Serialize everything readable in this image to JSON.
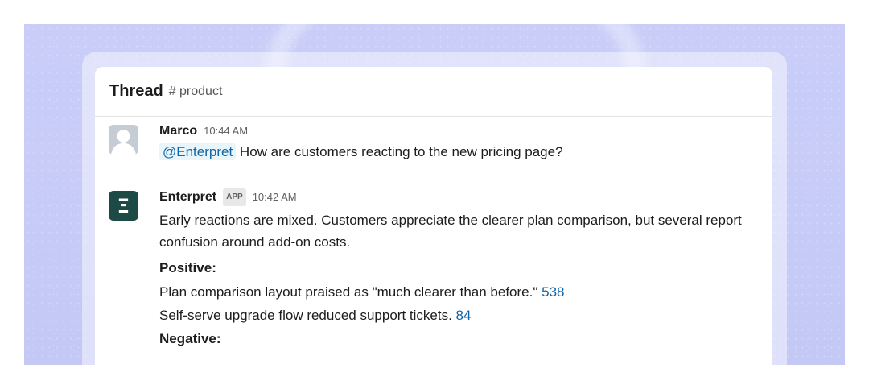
{
  "thread": {
    "title": "Thread",
    "channel": "# product"
  },
  "messages": [
    {
      "sender": "Marco",
      "time": "10:44 AM",
      "mention": "@Enterpret",
      "text": "How are customers reacting to the new pricing page?"
    },
    {
      "sender": "Enterpret",
      "badge": "APP",
      "time": "10:42 AM",
      "intro": "Early reactions are mixed. Customers appreciate the clearer plan comparison, but several report confusion around add-on costs.",
      "positive_heading": "Positive:",
      "positive_items": [
        {
          "text": "Plan comparison layout praised as \"much clearer than before.\"",
          "count": "538"
        },
        {
          "text": "Self-serve upgrade flow reduced support tickets.",
          "count": "84"
        }
      ],
      "negative_heading": "Negative:"
    }
  ],
  "colors": {
    "background": "#c9cdf8",
    "link": "#1264a3",
    "enterpret_avatar": "#1e4a45"
  }
}
